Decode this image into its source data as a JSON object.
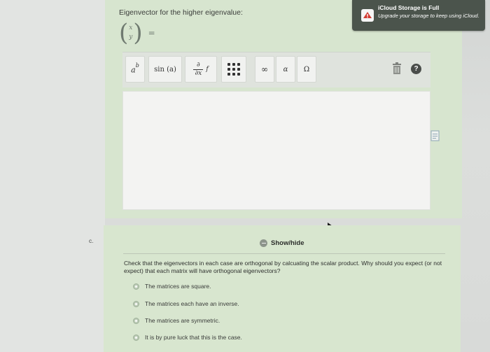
{
  "top_section": {
    "prompt": "Eigenvector for the higher eigenvalue:",
    "vector_top": "x",
    "vector_bottom": "y",
    "equals": "="
  },
  "toolbar": {
    "power_base": "a",
    "power_exp": "b",
    "sin_label": "sin (a)",
    "partial_top": "∂",
    "partial_bottom": "∂x",
    "partial_f": "f",
    "infinity": "∞",
    "alpha": "α",
    "omega": "Ω",
    "help": "?"
  },
  "icloud": {
    "title": "iCloud Storage is Full",
    "message": "Upgrade your storage to keep using iCloud."
  },
  "section_label": "c.",
  "show_hide": "Show/hide",
  "question": "Check that the eigenvectors in each case are orthogonal by calcuating the scalar product. Why should you expect (or not expect) that each matrix will have orthogonal eigenvectors?",
  "options": [
    "The matrices are square.",
    "The matrices each have an inverse.",
    "The matrices are symmetric.",
    "It is by pure luck that this is the case."
  ]
}
